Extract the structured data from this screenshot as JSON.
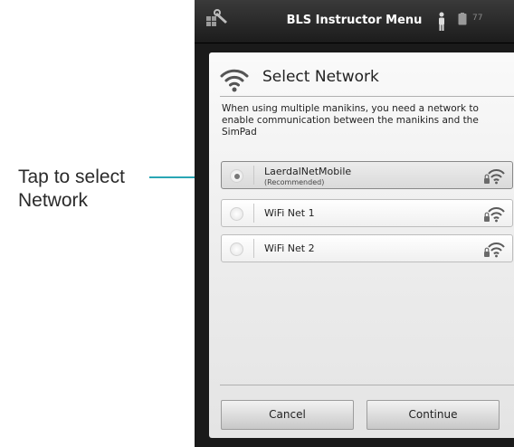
{
  "annotation": {
    "text": "Tap to select Network"
  },
  "status_bar": {
    "title": "BLS Instructor Menu",
    "battery_text": "77"
  },
  "dialog": {
    "title": "Select Network",
    "description": "When using multiple manikins, you need a network to enable communication between the manikins and the SimPad",
    "networks": [
      {
        "name": "LaerdalNetMobile",
        "note": "(Recommended)",
        "selected": true,
        "secured": true
      },
      {
        "name": "WiFi Net 1",
        "note": "",
        "selected": false,
        "secured": true
      },
      {
        "name": "WiFi Net 2",
        "note": "",
        "selected": false,
        "secured": true
      }
    ],
    "cancel_label": "Cancel",
    "continue_label": "Continue"
  },
  "colors": {
    "callout": "#2aa6b5",
    "status_bar_bg": "#2a2a2a",
    "wifi_icon": "#5a5a5a"
  }
}
